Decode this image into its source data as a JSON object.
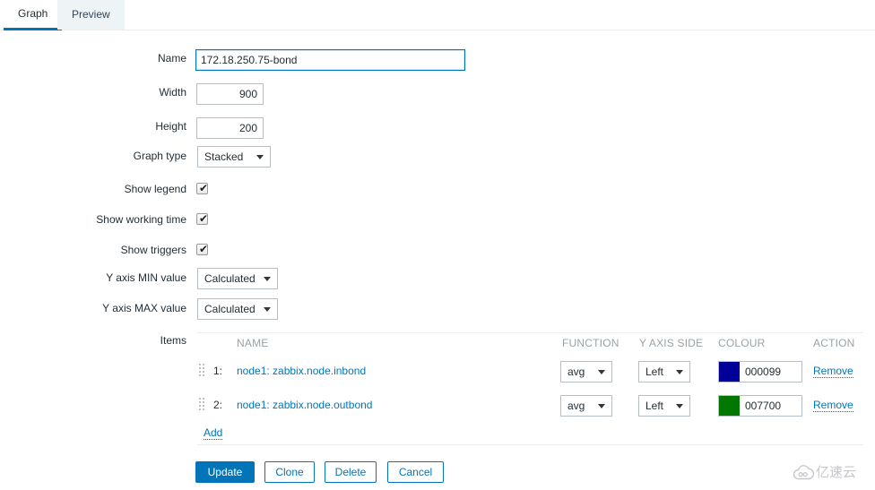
{
  "tabs": [
    {
      "label": "Graph",
      "active": true
    },
    {
      "label": "Preview",
      "active": false
    }
  ],
  "form": {
    "name": {
      "label": "Name",
      "value": "172.18.250.75-bond"
    },
    "width": {
      "label": "Width",
      "value": "900"
    },
    "height": {
      "label": "Height",
      "value": "200"
    },
    "graph_type": {
      "label": "Graph type",
      "value": "Stacked"
    },
    "show_legend": {
      "label": "Show legend",
      "checked": true
    },
    "show_working_time": {
      "label": "Show working time",
      "checked": true
    },
    "show_triggers": {
      "label": "Show triggers",
      "checked": true
    },
    "y_axis_min": {
      "label": "Y axis MIN value",
      "value": "Calculated"
    },
    "y_axis_max": {
      "label": "Y axis MAX value",
      "value": "Calculated"
    },
    "items_label": "Items"
  },
  "items_table": {
    "headers": {
      "name": "NAME",
      "function": "FUNCTION",
      "y_axis_side": "Y AXIS SIDE",
      "colour": "COLOUR",
      "action": "ACTION"
    },
    "rows": [
      {
        "index": "1:",
        "name": "node1: zabbix.node.inbond",
        "function": "avg",
        "y_axis_side": "Left",
        "colour": "000099",
        "colour_hex": "#000099",
        "action": "Remove"
      },
      {
        "index": "2:",
        "name": "node1: zabbix.node.outbond",
        "function": "avg",
        "y_axis_side": "Left",
        "colour": "007700",
        "colour_hex": "#007700",
        "action": "Remove"
      }
    ],
    "add_label": "Add"
  },
  "footer_buttons": {
    "update": "Update",
    "clone": "Clone",
    "delete": "Delete",
    "cancel": "Cancel"
  },
  "watermark": {
    "text": "亿速云"
  },
  "colors": {
    "accent": "#0275b8",
    "label_text": "#1f2c33",
    "muted_header": "#97a3ab",
    "border": "#b8bfc4"
  }
}
